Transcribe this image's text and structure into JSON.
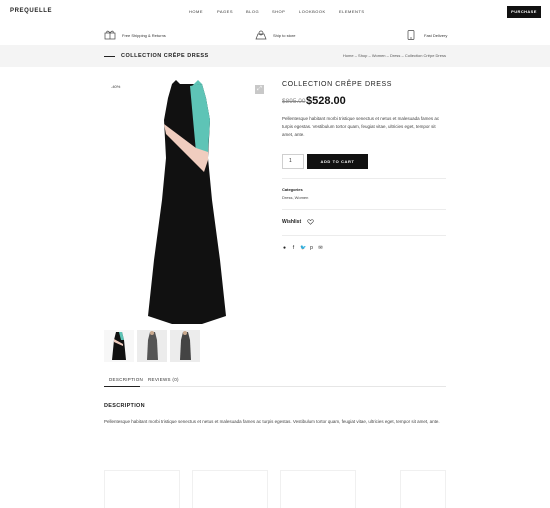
{
  "header": {
    "logo": "PREQUELLE",
    "nav": [
      "HOME",
      "PAGES",
      "BLOG",
      "SHOP",
      "LOOKBOOK",
      "ELEMENTS"
    ],
    "purchase_label": "PURCHASE"
  },
  "features": [
    {
      "icon": "gift-icon",
      "label": "Free Shipping & Returns"
    },
    {
      "icon": "store-icon",
      "label": "Ship to store"
    },
    {
      "icon": "phone-icon",
      "label": "Fast Delivery"
    }
  ],
  "page_title": "COLLECTION CRÊPE DRESS",
  "breadcrumb": "Home – Shop – Women – Dress – Collection Crêpe Dress",
  "gallery": {
    "discount": "-40%",
    "colors": {
      "teal": "#5ec4b6",
      "pink": "#f0cdbf",
      "black": "#111111"
    }
  },
  "product": {
    "title": "COLLECTION CRÊPE DRESS",
    "price_old": "$895.00",
    "price_new": "$528.00",
    "summary": "Pellentesque habitant morbi tristique senectus et netus et malesuada fames ac turpis egestas. Vestibulum tortor quam, feugiat vitae, ultricies eget, tempor sit amet, ante.",
    "quantity": "1",
    "add_to_cart": "ADD TO CART",
    "categories_label": "Categories",
    "categories_value": "Dress, Women",
    "wishlist_label": "Wishlist"
  },
  "tabs": [
    "DESCRIPTION",
    "REVIEWS (0)"
  ],
  "description": {
    "heading": "DESCRIPTION",
    "text": "Pellentesque habitant morbi tristique senectus et netus et malesuada fames ac turpis egestas. Vestibulum tortor quam, feugiat vitae, ultricies eget, tempor sit amet, ante."
  }
}
